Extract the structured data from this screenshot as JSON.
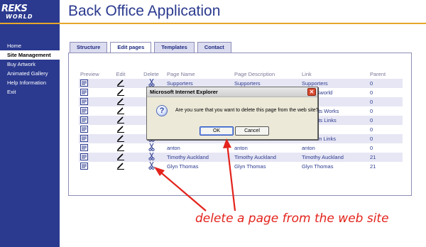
{
  "brand": {
    "logo_line1": "REKS",
    "logo_line2": "WORLD"
  },
  "header": {
    "title": "Back Office Application"
  },
  "sidebar": {
    "items": [
      {
        "label": "Home",
        "active": false
      },
      {
        "label": "Site Management",
        "active": true
      },
      {
        "label": "Buy Artwork",
        "active": false
      },
      {
        "label": "Animated Gallery",
        "active": false
      },
      {
        "label": "Help Information",
        "active": false
      },
      {
        "label": "Exit",
        "active": false
      }
    ]
  },
  "tabs": [
    {
      "label": "Structure",
      "active": false
    },
    {
      "label": "Edit pages",
      "active": true
    },
    {
      "label": "Templates",
      "active": false
    },
    {
      "label": "Contact",
      "active": false
    }
  ],
  "table": {
    "headers": [
      "Preview",
      "Edit",
      "Delete",
      "Page Name",
      "Page Description",
      "Link",
      "Parent"
    ],
    "rows": [
      {
        "name": "Supporters",
        "desc": "Supporters",
        "link": "Supporters",
        "parent": "0"
      },
      {
        "name": "",
        "desc": "",
        "link": "ut Reksworld",
        "parent": "0"
      },
      {
        "name": "",
        "desc": "",
        "link": "ut ReK",
        "parent": "0"
      },
      {
        "name": "",
        "desc": "",
        "link": "er Artists Works",
        "parent": "0"
      },
      {
        "name": "",
        "desc": "",
        "link": "er Artists Links",
        "parent": "0"
      },
      {
        "name": "",
        "desc": "",
        "link": "tact us",
        "parent": "0"
      },
      {
        "name": "Random Links",
        "desc": "Random Links",
        "link": "Random Links",
        "parent": "0"
      },
      {
        "name": "anton",
        "desc": "anton",
        "link": "anton",
        "parent": "0"
      },
      {
        "name": "Timothy Auckland",
        "desc": "Timothy Auckland",
        "link": "Timothy Auckland",
        "parent": "21"
      },
      {
        "name": "Glyn Thomas",
        "desc": "Glyn Thomas",
        "link": "Glyn Thomas",
        "parent": "21"
      }
    ]
  },
  "dialog": {
    "title": "Microsoft Internet Explorer",
    "close_label": "✕",
    "icon_glyph": "?",
    "message": "Are you sure that you want to delete this page from the web site?",
    "ok_label": "OK",
    "cancel_label": "Cancel"
  },
  "annotation": {
    "caption": "delete a page from the web site",
    "color": "#e3231c"
  },
  "colors": {
    "brand_blue": "#2b3a8f",
    "accent_orange": "#e6a628",
    "row_alt": "#e6e6f4"
  },
  "icons": {
    "preview": "preview-icon",
    "edit": "pencil-icon",
    "delete": "scissors-icon"
  }
}
